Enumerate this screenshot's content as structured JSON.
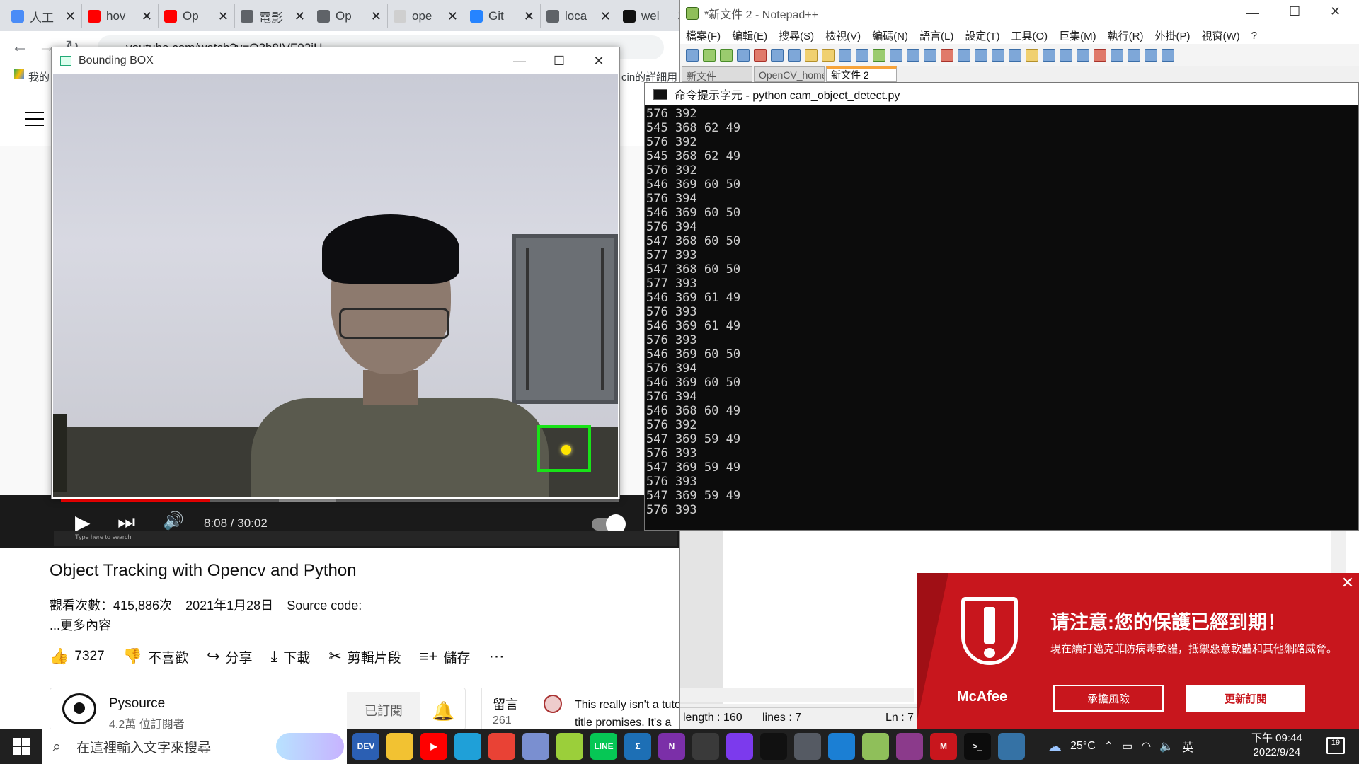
{
  "chrome": {
    "tabs": [
      {
        "label": "人工",
        "color": "#4a8cf7"
      },
      {
        "label": "hov",
        "color": "#ff0000"
      },
      {
        "label": "Op",
        "color": "#ff0000"
      },
      {
        "label": "電影",
        "color": "#5f6368"
      },
      {
        "label": "Op",
        "color": "#5f6368"
      },
      {
        "label": "ope",
        "color": "#cfcfcf"
      },
      {
        "label": "Git",
        "color": "#2684ff"
      },
      {
        "label": "loca",
        "color": "#5f6368"
      },
      {
        "label": "wel",
        "color": "#111111"
      }
    ],
    "url": "youtube.com/watch?v=O3b8IVF93jU",
    "bookmarks_left": "我的",
    "bookmarks_right": "cin的詳細用"
  },
  "bbox_window": {
    "title": "Bounding BOX",
    "minimize": "—",
    "maximize": "☐",
    "close": "✕",
    "box_color": "#18e318",
    "tracker_color": "#ffe600"
  },
  "player": {
    "time": "8:08 / 30:02",
    "progress_fraction": 0.268,
    "snap_search": "Type here to search"
  },
  "video": {
    "title": "Object Tracking with Opencv and Python",
    "views": "觀看次數：415,886次",
    "date": "2021年1月28日",
    "source": "Source code:",
    "more": "...更多內容",
    "actions": {
      "like": "7327",
      "dislike": "不喜歡",
      "share": "分享",
      "download": "下載",
      "clip": "剪輯片段",
      "save": "儲存",
      "more": "⋯"
    },
    "channel": {
      "name": "Pysource",
      "subscribers": "4.2萬 位訂閱者",
      "subscribed": "已訂閱"
    },
    "comments": {
      "label": "留言",
      "count": "261",
      "text_line1": "This really isn't a tuto",
      "text_line2": "title promises. It's a"
    }
  },
  "notepad": {
    "title": "*新文件 2 - Notepad++",
    "menu": [
      "檔案(F)",
      "編輯(E)",
      "搜尋(S)",
      "檢視(V)",
      "編碼(N)",
      "語言(L)",
      "設定(T)",
      "工具(O)",
      "巨集(M)",
      "執行(R)",
      "外掛(P)",
      "視窗(W)",
      "?"
    ],
    "tabs": [
      "新文件",
      "OpenCV_homework",
      "新文件 2"
    ],
    "status": {
      "length": "length : 160",
      "lines": "lines : 7",
      "ln": "Ln : 7"
    }
  },
  "cmd": {
    "title": "命令提示字元 - python  cam_object_detect.py",
    "lines": [
      "576 392",
      "545 368 62 49",
      "576 392",
      "545 368 62 49",
      "576 392",
      "546 369 60 50",
      "576 394",
      "546 369 60 50",
      "576 394",
      "547 368 60 50",
      "577 393",
      "547 368 60 50",
      "577 393",
      "546 369 61 49",
      "576 393",
      "546 369 61 49",
      "576 393",
      "546 369 60 50",
      "576 394",
      "546 369 60 50",
      "576 394",
      "546 368 60 49",
      "576 392",
      "547 369 59 49",
      "576 393",
      "547 369 59 49",
      "576 393",
      "547 369 59 49",
      "576 393"
    ]
  },
  "mcafee": {
    "heading": "请注意:您的保護已經到期！",
    "body": "現在續訂邁克菲防病毒軟體，抵禦惡意軟體和其他網路威脅。",
    "logo": "McAfee",
    "btn_risk": "承擔風險",
    "btn_renew": "更新訂閱",
    "close": "✕"
  },
  "taskbar": {
    "search_placeholder": "在這裡輸入文字來搜尋",
    "weather": "25°C",
    "ime": "英",
    "time": "下午 09:44",
    "date": "2022/9/24",
    "notifications": "19",
    "apps": [
      {
        "name": "dev-cpp",
        "label": "DEV",
        "color": "#2b5fb3"
      },
      {
        "name": "file-explorer",
        "label": "",
        "color": "#f2c232"
      },
      {
        "name": "youtube",
        "label": "▶",
        "color": "#ff0000"
      },
      {
        "name": "edge",
        "label": "",
        "color": "#1fa0d8"
      },
      {
        "name": "chrome",
        "label": "",
        "color": "#e94235"
      },
      {
        "name": "paint-brush",
        "label": "",
        "color": "#7a8fd0"
      },
      {
        "name": "pea",
        "label": "",
        "color": "#9bcf3a"
      },
      {
        "name": "line",
        "label": "LINE",
        "color": "#06c755"
      },
      {
        "name": "sigma",
        "label": "Σ",
        "color": "#1d6fb5"
      },
      {
        "name": "onenote",
        "label": "N",
        "color": "#7b2fa8"
      },
      {
        "name": "snip",
        "label": "",
        "color": "#3a3a3a"
      },
      {
        "name": "obsidian",
        "label": "",
        "color": "#7c3aed"
      },
      {
        "name": "capcut",
        "label": "",
        "color": "#111111"
      },
      {
        "name": "camera",
        "label": "",
        "color": "#555a63"
      },
      {
        "name": "photos",
        "label": "",
        "color": "#1b7fd4"
      },
      {
        "name": "notepad-plus-plus",
        "label": "",
        "color": "#8fbf5a"
      },
      {
        "name": "winrar",
        "label": "",
        "color": "#8b3a8b"
      },
      {
        "name": "mcafee",
        "label": "M",
        "color": "#c8161d"
      },
      {
        "name": "cmd",
        "label": ">_",
        "color": "#0c0c0c"
      },
      {
        "name": "python",
        "label": "",
        "color": "#3572a5"
      }
    ]
  }
}
